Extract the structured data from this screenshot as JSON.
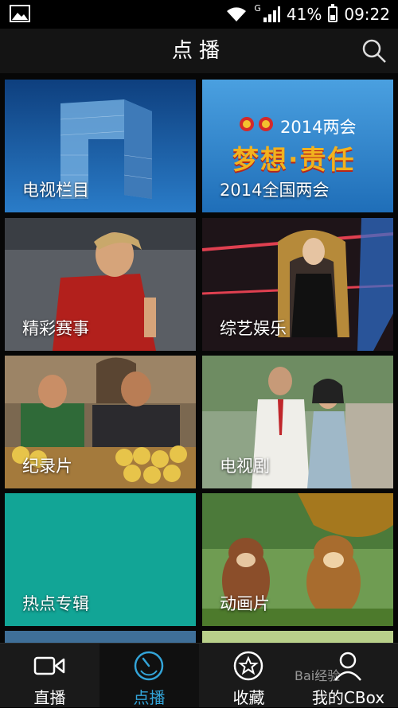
{
  "status": {
    "network_type": "G",
    "battery": "41%",
    "battery_level": 0.41,
    "time": "09:22"
  },
  "header": {
    "title": "点播"
  },
  "tiles": [
    {
      "label": "电视栏目",
      "bg": "#1c5aa0"
    },
    {
      "label": "2014全国两会",
      "bg": "#2c7fc4",
      "banner_year": "2014两会",
      "banner_slogan": "梦想·责任"
    },
    {
      "label": "精彩赛事",
      "bg": "#7a2a24"
    },
    {
      "label": "综艺娱乐",
      "bg": "#3a2a30"
    },
    {
      "label": "纪录片",
      "bg": "#6e5a3a"
    },
    {
      "label": "电视剧",
      "bg": "#6f8a6a"
    },
    {
      "label": "热点专辑",
      "bg": "#12a596"
    },
    {
      "label": "动画片",
      "bg": "#5b8a3a"
    }
  ],
  "tabbar": {
    "items": [
      {
        "label": "直播",
        "icon": "video-camera-icon"
      },
      {
        "label": "点播",
        "icon": "play-dial-icon"
      },
      {
        "label": "收藏",
        "icon": "star-circle-icon"
      },
      {
        "label": "我的CBox",
        "icon": "user-icon"
      }
    ],
    "active_color": "#33a4d8"
  },
  "watermark": "Bai经验"
}
